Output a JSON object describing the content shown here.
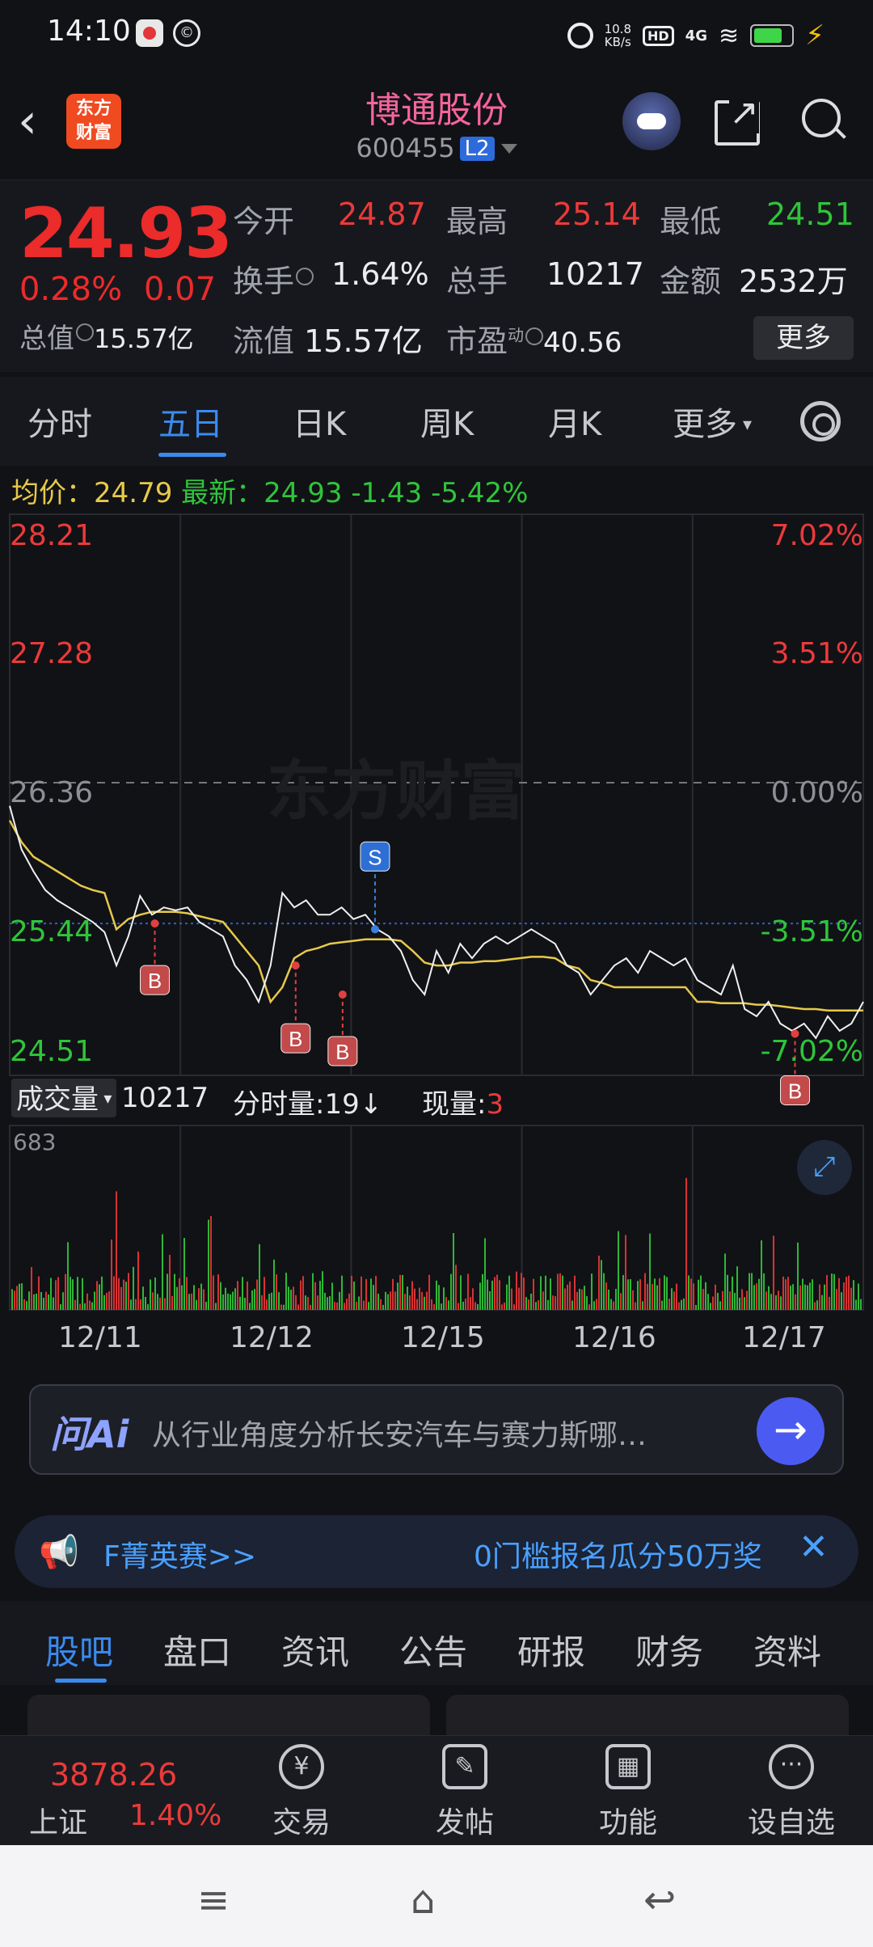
{
  "status_bar": {
    "time": "14:10",
    "net_speed": "10.8\nKB/s",
    "hd": "HD",
    "signal": "4G",
    "icons": [
      "record-app-icon",
      "app-icon",
      "alarm-icon",
      "hd-icon",
      "signal-icon",
      "wifi-icon",
      "battery-icon",
      "charging-icon"
    ]
  },
  "header": {
    "logo_text": "东方\n财富",
    "title": "博通股份",
    "code": "600455",
    "level_badge": "L2"
  },
  "quote": {
    "price": "24.93",
    "change_pct": "0.28%",
    "change": "0.07",
    "open_label": "今开",
    "open": "24.87",
    "high_label": "最高",
    "high": "25.14",
    "low_label": "最低",
    "low": "24.51",
    "turnover_label": "换手",
    "turnover": "1.64%",
    "volume_label": "总手",
    "volume": "10217",
    "amount_label": "金额",
    "amount": "2532万",
    "mktcap_label": "总值",
    "mktcap": "15.57亿",
    "float_label": "流值",
    "float": "15.57亿",
    "pe_label": "市盈",
    "pe_sup": "动",
    "pe": "40.56",
    "more_label": "更多"
  },
  "chart_tabs": [
    "分时",
    "五日",
    "日K",
    "周K",
    "月K",
    "更多"
  ],
  "active_tab": "五日",
  "avg_line": {
    "avg_label": "均价：",
    "avg": "24.79",
    "latest_label": "最新：",
    "latest": "24.93",
    "chg": "-1.43",
    "pct": "-5.42%"
  },
  "chart_data": {
    "type": "line",
    "watermark": "东方财富",
    "y_labels_left": [
      "28.21",
      "27.28",
      "26.36",
      "25.44",
      "24.51"
    ],
    "y_labels_right": [
      "7.02%",
      "3.51%",
      "0.00%",
      "-3.51%",
      "-7.02%"
    ],
    "ylim": [
      24.51,
      28.21
    ],
    "prev_close": 26.36,
    "x_dates": [
      "12/11",
      "12/12",
      "12/15",
      "12/16",
      "12/17"
    ],
    "price_series": {
      "name": "price",
      "values": [
        26.2,
        25.9,
        25.75,
        25.62,
        25.55,
        25.5,
        25.45,
        25.4,
        25.33,
        25.1,
        25.3,
        25.58,
        25.45,
        25.5,
        25.48,
        25.5,
        25.4,
        25.35,
        25.3,
        25.1,
        25.0,
        24.85,
        25.1,
        25.6,
        25.5,
        25.55,
        25.45,
        25.45,
        25.5,
        25.42,
        25.45,
        25.35,
        25.3,
        25.2,
        25.0,
        24.9,
        25.2,
        25.05,
        25.25,
        25.15,
        25.25,
        25.3,
        25.25,
        25.3,
        25.35,
        25.3,
        25.25,
        25.1,
        25.05,
        24.9,
        25.0,
        25.1,
        25.15,
        25.05,
        25.2,
        25.15,
        25.1,
        25.15,
        25.0,
        24.95,
        24.9,
        25.1,
        24.8,
        24.75,
        24.85,
        24.7,
        24.65,
        24.7,
        24.6,
        24.75,
        24.65,
        24.7,
        24.85
      ]
    },
    "avg_series": {
      "name": "avg",
      "values": [
        26.1,
        25.95,
        25.85,
        25.8,
        25.75,
        25.7,
        25.65,
        25.62,
        25.6,
        25.35,
        25.42,
        25.45,
        25.47,
        25.47,
        25.47,
        25.46,
        25.44,
        25.42,
        25.4,
        25.3,
        25.2,
        25.1,
        24.85,
        24.95,
        25.15,
        25.2,
        25.22,
        25.25,
        25.26,
        25.27,
        25.28,
        25.28,
        25.28,
        25.27,
        25.2,
        25.12,
        25.1,
        25.1,
        25.12,
        25.12,
        25.13,
        25.13,
        25.14,
        25.15,
        25.16,
        25.16,
        25.15,
        25.1,
        25.08,
        25.0,
        24.98,
        24.95,
        24.95,
        24.95,
        24.95,
        24.95,
        24.95,
        24.95,
        24.85,
        24.85,
        24.84,
        24.84,
        24.84,
        24.83,
        24.83,
        24.82,
        24.81,
        24.8,
        24.8,
        24.79,
        24.79,
        24.79,
        24.79
      ]
    },
    "markers": [
      {
        "label": "B",
        "price": 25.39,
        "x_frac": 0.17,
        "type": "buy"
      },
      {
        "label": "B",
        "price": 25.1,
        "x_frac": 0.335,
        "type": "buy"
      },
      {
        "label": "B",
        "price": 24.9,
        "x_frac": 0.39,
        "type": "buy"
      },
      {
        "label": "S",
        "price": 25.35,
        "x_frac": 0.428,
        "type": "sell"
      },
      {
        "label": "B",
        "price": 24.63,
        "x_frac": 0.92,
        "type": "buy"
      }
    ]
  },
  "volume": {
    "selector": "成交量",
    "total": "10217",
    "tick_label": "分时量:19↓",
    "current_label": "现量:",
    "current": "3",
    "max": "683"
  },
  "ai_box": {
    "brand": "问Ai",
    "question": "从行业角度分析长安汽车与赛力斯哪…"
  },
  "banner": {
    "left": "F菁英赛>>",
    "right": "0门槛报名瓜分50万奖"
  },
  "bottom_tabs": [
    "股吧",
    "盘口",
    "资讯",
    "公告",
    "研报",
    "财务",
    "资料"
  ],
  "footer": {
    "index_value": "3878.26",
    "index_name": "上证",
    "index_pct": "1.40%",
    "items": [
      "交易",
      "发帖",
      "功能",
      "设自选"
    ]
  }
}
